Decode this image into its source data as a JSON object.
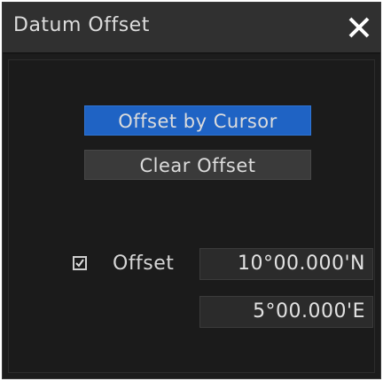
{
  "window": {
    "title": "Datum Offset"
  },
  "buttons": {
    "offset_by_cursor": "Offset by Cursor",
    "clear_offset": "Clear Offset"
  },
  "offset": {
    "checked": true,
    "label": "Offset",
    "latitude": "10°00.000'N",
    "longitude": "5°00.000'E"
  },
  "colors": {
    "window_bg": "#1c1c1c",
    "titlebar_bg": "#303030",
    "primary_button": "#1f63c4",
    "secondary_button": "#3a3a3a",
    "field_bg": "#2b2b2b",
    "text": "#dcdcdc"
  },
  "icons": {
    "close": "close-icon",
    "check": "checkmark-icon"
  }
}
